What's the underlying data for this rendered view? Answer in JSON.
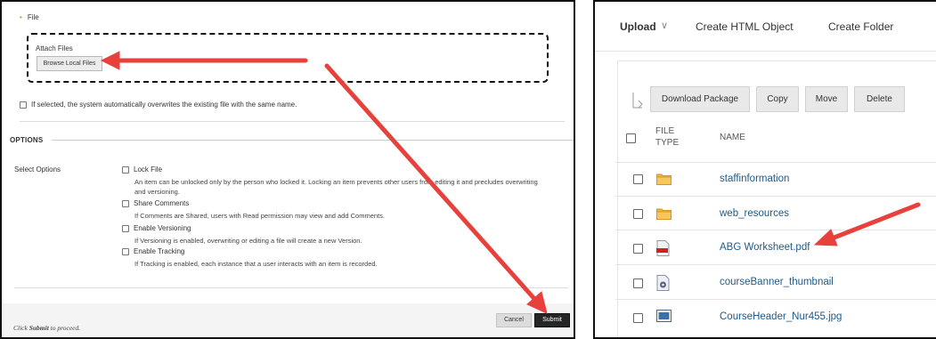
{
  "left_panel": {
    "file_label": "File",
    "required_marker": "•",
    "attach_label": "Attach Files",
    "browse_button": "Browse Local Files",
    "overwrite_text": "If selected, the system automatically overwrites the existing file with the same name.",
    "options_heading": "OPTIONS",
    "select_options_label": "Select Options",
    "options": [
      {
        "label": "Lock File",
        "checked": false,
        "description": "An item can be unlocked only by the person who locked it. Locking an item prevents other users from editing it and precludes overwriting and versioning."
      },
      {
        "label": "Share Comments",
        "checked": false,
        "description": "If Comments are Shared, users with Read permission may view and add Comments."
      },
      {
        "label": "Enable Versioning",
        "checked": false,
        "description": "If Versioning is enabled, overwriting or editing a file will create a new Version."
      },
      {
        "label": "Enable Tracking",
        "checked": false,
        "description": "If Tracking is enabled, each instance that a user interacts with an item is recorded."
      }
    ],
    "footer": {
      "proceed_prefix": "Click ",
      "proceed_bold": "Submit",
      "proceed_suffix": " to proceed.",
      "cancel_button": "Cancel",
      "submit_button": "Submit"
    }
  },
  "right_panel": {
    "nav": {
      "upload": "Upload",
      "upload_chevron": "∨",
      "create_html": "Create HTML Object",
      "create_folder": "Create Folder"
    },
    "toolbar": [
      "Download Package",
      "Copy",
      "Move",
      "Delete"
    ],
    "columns": {
      "file_type_line1": "FILE",
      "file_type_line2": "TYPE",
      "name": "NAME"
    },
    "files": [
      {
        "name": "staffinformation",
        "icon": "folder-icon"
      },
      {
        "name": "web_resources",
        "icon": "folder-icon"
      },
      {
        "name": "ABG Worksheet.pdf",
        "icon": "pdf-icon"
      },
      {
        "name": "courseBanner_thumbnail",
        "icon": "gear-file-icon"
      },
      {
        "name": "CourseHeader_Nur455.jpg",
        "icon": "image-icon"
      }
    ]
  },
  "colors": {
    "arrow": "#e8413c",
    "link": "#1e5a8a",
    "folder": "#f2b441",
    "submit_bg": "#262626",
    "required": "#e0822a"
  }
}
